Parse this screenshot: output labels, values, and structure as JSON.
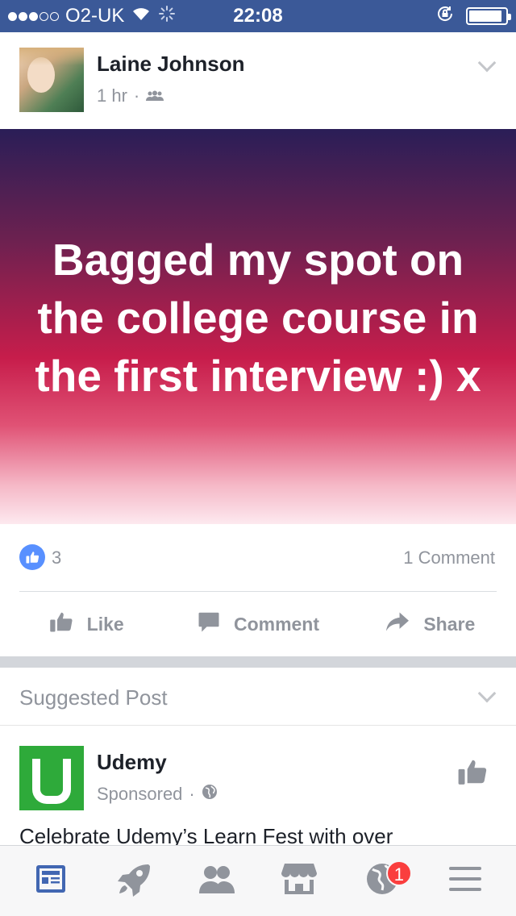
{
  "status_bar": {
    "signal_dots_filled": 3,
    "signal_dots_total": 5,
    "carrier": "O2-UK",
    "time": "22:08",
    "battery_level": 0.9
  },
  "post": {
    "author": "Laine Johnson",
    "timestamp": "1 hr",
    "separator": "·",
    "audience_icon": "friends-icon",
    "text": "Bagged my spot on the college course in the first interview :) x",
    "reaction_count": "3",
    "comment_count": "1 Comment",
    "actions": {
      "like": "Like",
      "comment": "Comment",
      "share": "Share"
    }
  },
  "suggested": {
    "label": "Suggested Post",
    "advertiser": "Udemy",
    "sponsored": "Sponsored",
    "separator": "·",
    "audience_icon": "globe-icon",
    "text": "Celebrate Udemy’s Learn Fest with over"
  },
  "tab_bar": {
    "tabs": [
      {
        "icon": "news-feed-icon",
        "active": true
      },
      {
        "icon": "rocket-icon",
        "active": false
      },
      {
        "icon": "friends-icon",
        "active": false
      },
      {
        "icon": "marketplace-icon",
        "active": false
      },
      {
        "icon": "notifications-globe-icon",
        "active": false,
        "badge": "1"
      },
      {
        "icon": "menu-icon",
        "active": false
      }
    ]
  },
  "colors": {
    "facebook_blue": "#3b5998",
    "like_blue": "#5890ff",
    "muted_text": "#90949c",
    "badge_red": "#fa3e3e",
    "udemy_green": "#2eaa3a"
  }
}
